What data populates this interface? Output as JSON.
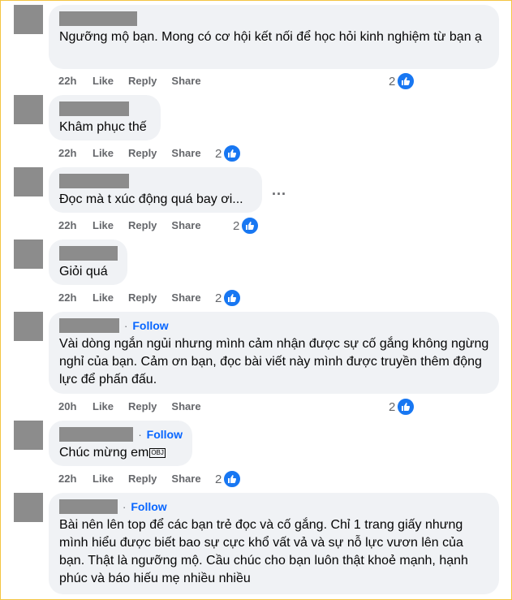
{
  "colors": {
    "accent": "#0866ff",
    "bubble": "#f0f2f5",
    "like": "#1877f2",
    "muted": "#65676b"
  },
  "icons": {
    "like": "thumbs-up-icon",
    "more": "more-options-icon"
  },
  "actions": {
    "like": "Like",
    "reply": "Reply",
    "share": "Share"
  },
  "comments": [
    {
      "text": "Ngưỡng mộ bạn. Mong có cơ hội kết nối để học hỏi kinh nghiệm từ bạn ạ",
      "time": "22h",
      "reactions": "2",
      "follow": ""
    },
    {
      "text": "Khâm phục thế",
      "time": "22h",
      "reactions": "2",
      "follow": ""
    },
    {
      "text": "Đọc mà t xúc động quá bay ơi...",
      "time": "22h",
      "reactions": "2",
      "follow": "",
      "more": "..."
    },
    {
      "text": "Giỏi quá",
      "time": "22h",
      "reactions": "2",
      "follow": ""
    },
    {
      "text": "Vài dòng ngắn ngủi nhưng mình cảm nhận được sự cố gắng không ngừng nghỉ của bạn. Cảm ơn bạn, đọc bài viết này mình được truyền thêm động lực để phấn đấu.",
      "time": "20h",
      "reactions": "2",
      "follow": "Follow"
    },
    {
      "text": "Chúc mừng em",
      "badge": "OBJ",
      "time": "22h",
      "reactions": "2",
      "follow": "Follow"
    },
    {
      "text": "Bài nên lên top để các bạn trẻ đọc và cố gắng. Chỉ 1 trang giấy nhưng mình hiểu được biết bao sự cực khổ vất vả và sự nỗ lực vươn lên của bạn. Thật là ngưỡng mộ. Cầu chúc cho bạn luôn thật khoẻ mạnh, hạnh phúc và báo hiếu mẹ nhiều nhiều",
      "time": "",
      "reactions": "",
      "follow": "Follow"
    }
  ]
}
